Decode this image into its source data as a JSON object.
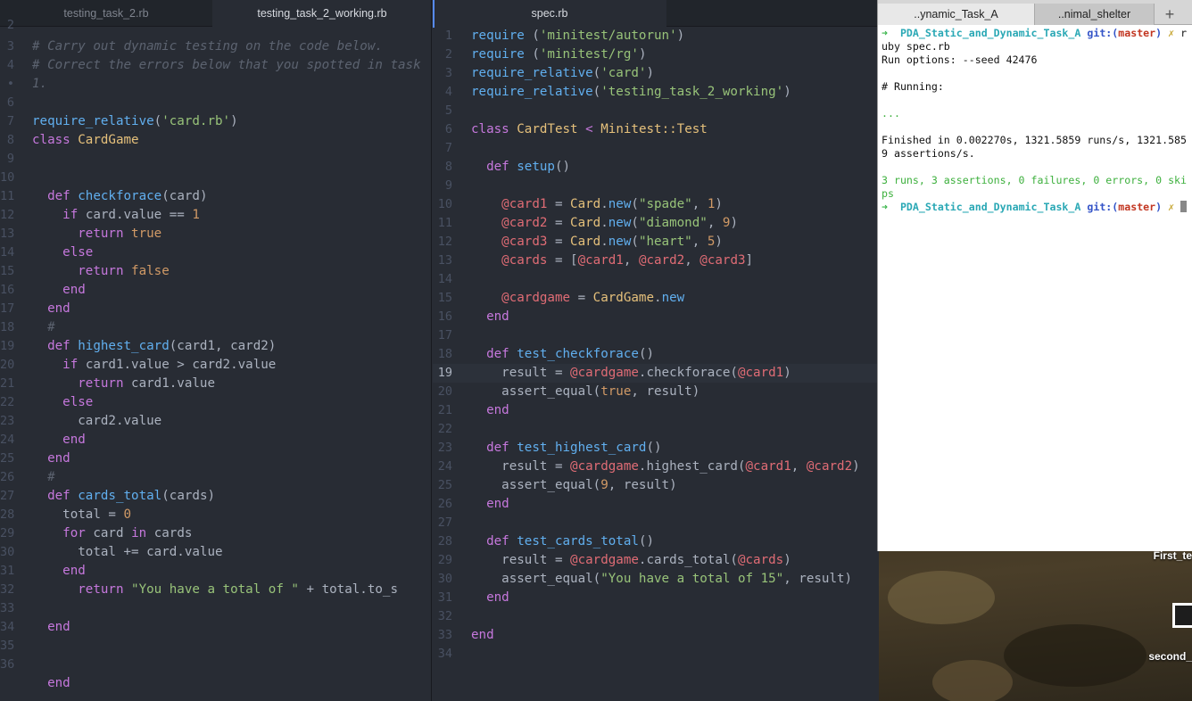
{
  "left_pane": {
    "tabs": [
      {
        "label": "testing_task_2.rb"
      },
      {
        "label": "testing_task_2_working.rb"
      }
    ],
    "line_numbers": [
      "2",
      "3",
      "4",
      "•",
      "6",
      "7",
      "8",
      "9",
      "10",
      "11",
      "12",
      "13",
      "14",
      "15",
      "16",
      "17",
      "18",
      "19",
      "20",
      "21",
      "22",
      "23",
      "24",
      "25",
      "26",
      "27",
      "28",
      "29",
      "30",
      "31",
      "32",
      "33",
      "34",
      "35",
      "36"
    ],
    "code": {
      "l3": "# Carry out dynamic testing on the code below.",
      "l4": "# Correct the errors below that you spotted in task",
      "l4b": "1.",
      "l6a": "require_relative",
      "l6b": "(",
      "l6c": "'card.rb'",
      "l6d": ")",
      "l7a": "class",
      "l7b": "CardGame",
      "l10a": "def",
      "l10b": "checkforace",
      "l10c": "(card)",
      "l11a": "if",
      "l11b": "card.value ==",
      "l11c": "1",
      "l12a": "return",
      "l12b": "true",
      "l13": "else",
      "l14a": "return",
      "l14b": "false",
      "l15": "end",
      "l16": "end",
      "l17": "#",
      "l18a": "def",
      "l18b": "highest_card",
      "l18c": "(card1, card2)",
      "l19a": "if",
      "l19b": "card1.value > card2.value",
      "l20a": "return",
      "l20b": "card1.value",
      "l21": "else",
      "l22": "card2.value",
      "l23": "end",
      "l24": "end",
      "l25": "#",
      "l26a": "def",
      "l26b": "cards_total",
      "l26c": "(cards)",
      "l27a": "total =",
      "l27b": "0",
      "l28a": "for",
      "l28b": "card",
      "l28c": "in",
      "l28d": "cards",
      "l29": "total += card.value",
      "l30": "end",
      "l31a": "return",
      "l31b": "\"You have a total of \"",
      "l31c": "+ total.to_s",
      "l33": "end",
      "l36": "end"
    }
  },
  "right_pane": {
    "tabs": [
      {
        "label": "spec.rb"
      }
    ],
    "line_numbers": [
      "1",
      "2",
      "3",
      "4",
      "5",
      "6",
      "7",
      "8",
      "9",
      "10",
      "11",
      "12",
      "13",
      "14",
      "15",
      "16",
      "17",
      "18",
      "19",
      "20",
      "21",
      "22",
      "23",
      "24",
      "25",
      "26",
      "27",
      "28",
      "29",
      "30",
      "31",
      "32",
      "33",
      "34"
    ],
    "code": {
      "r1a": "require",
      "r1b": "(",
      "r1c": "'minitest/autorun'",
      "r1d": ")",
      "r2a": "require",
      "r2b": "(",
      "r2c": "'minitest/rg'",
      "r2d": ")",
      "r3a": "require_relative",
      "r3b": "(",
      "r3c": "'card'",
      "r3d": ")",
      "r4a": "require_relative",
      "r4b": "(",
      "r4c": "'testing_task_2_working'",
      "r4d": ")",
      "r6a": "class",
      "r6b": "CardTest",
      "r6c": "<",
      "r6d": "Minitest::Test",
      "r8a": "def",
      "r8b": "setup",
      "r8c": "()",
      "r10a": "@card1",
      "r10b": " = ",
      "r10c": "Card",
      "r10d": ".",
      "r10e": "new",
      "r10f": "(",
      "r10g": "\"spade\"",
      "r10h": ", ",
      "r10i": "1",
      "r10j": ")",
      "r11a": "@card2",
      "r11b": " = ",
      "r11c": "Card",
      "r11d": ".",
      "r11e": "new",
      "r11f": "(",
      "r11g": "\"diamond\"",
      "r11h": ", ",
      "r11i": "9",
      "r11j": ")",
      "r12a": "@card3",
      "r12b": " = ",
      "r12c": "Card",
      "r12d": ".",
      "r12e": "new",
      "r12f": "(",
      "r12g": "\"heart\"",
      "r12h": ", ",
      "r12i": "5",
      "r12j": ")",
      "r13a": "@cards",
      "r13b": " = [",
      "r13c": "@card1",
      "r13d": ", ",
      "r13e": "@card2",
      "r13f": ", ",
      "r13g": "@card3",
      "r13h": "]",
      "r15a": "@cardgame",
      "r15b": " = ",
      "r15c": "CardGame",
      "r15d": ".",
      "r15e": "new",
      "r16": "end",
      "r18a": "def",
      "r18b": "test_checkforace",
      "r18c": "()",
      "r19a": "result = ",
      "r19b": "@cardgame",
      "r19c": ".checkforace(",
      "r19d": "@card1",
      "r19e": ")",
      "r20a": "assert_equal(",
      "r20b": "true",
      "r20c": ", result)",
      "r21": "end",
      "r23a": "def",
      "r23b": "test_highest_card",
      "r23c": "()",
      "r24a": "result = ",
      "r24b": "@cardgame",
      "r24c": ".highest_card(",
      "r24d": "@card1",
      "r24e": ", ",
      "r24f": "@card2",
      "r24g": ")",
      "r25a": "assert_equal(",
      "r25b": "9",
      "r25c": ", result)",
      "r26": "end",
      "r28a": "def",
      "r28b": "test_cards_total",
      "r28c": "()",
      "r29a": "result = ",
      "r29b": "@cardgame",
      "r29c": ".cards_total(",
      "r29d": "@cards",
      "r29e": ")",
      "r30a": "assert_equal(",
      "r30b": "\"You have a total of 15\"",
      "r30c": ", result)",
      "r31": "end",
      "r33": "end"
    }
  },
  "terminal": {
    "tabs": [
      {
        "label": "..ynamic_Task_A"
      },
      {
        "label": "..nimal_shelter"
      }
    ],
    "add_tab": "+",
    "lines": {
      "p1_arrow": "➜",
      "p1_dir": "PDA_Static_and_Dynamic_Task_A",
      "p1_git": "git:(",
      "p1_branch": "master",
      "p1_close": ")",
      "p1_x": "✗",
      "p1_cmd": "r",
      "l2": "uby spec.rb",
      "l3": "Run options: --seed 42476",
      "l5": "# Running:",
      "l7": "...",
      "l9": "Finished in 0.002270s, 1321.5859 runs/s, 1321.585",
      "l10": "9 assertions/s.",
      "l12": "3 runs, 3 assertions, 0 failures, 0 errors, 0 ski",
      "l13": "ps",
      "p2_arrow": "➜",
      "p2_dir": "PDA_Static_and_Dynamic_Task_A",
      "p2_git": "git:(",
      "p2_branch": "master",
      "p2_close": ")",
      "p2_x": "✗"
    }
  },
  "desktop": {
    "label_1": "First_te",
    "label_2": "second_"
  }
}
